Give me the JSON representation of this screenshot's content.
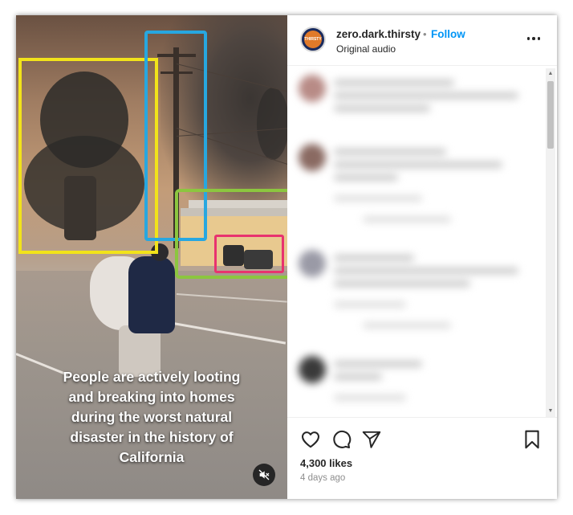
{
  "post": {
    "username": "zero.dark.thirsty",
    "follow_label": "Follow",
    "separator": "•",
    "audio": "Original audio",
    "avatar_text": "THIRSTY",
    "likes": "4,300 likes",
    "date": "4 days ago"
  },
  "video": {
    "caption": "People are actively looting\nand breaking into homes\nduring the worst natural\ndisaster in the history of\nCalifornia",
    "muted": true
  },
  "annotations": {
    "colors": {
      "yellow": "#f2e31a",
      "blue": "#27a7e0",
      "green": "#8cc63f",
      "red": "#e8336f"
    }
  },
  "icons": {
    "like": "heart-icon",
    "comment": "comment-icon",
    "share": "send-icon",
    "save": "bookmark-icon",
    "more": "more-options-icon",
    "mute": "muted-speaker-icon"
  },
  "colors": {
    "link": "#0095f6",
    "text": "#262626",
    "muted_text": "#8e8e8e"
  }
}
